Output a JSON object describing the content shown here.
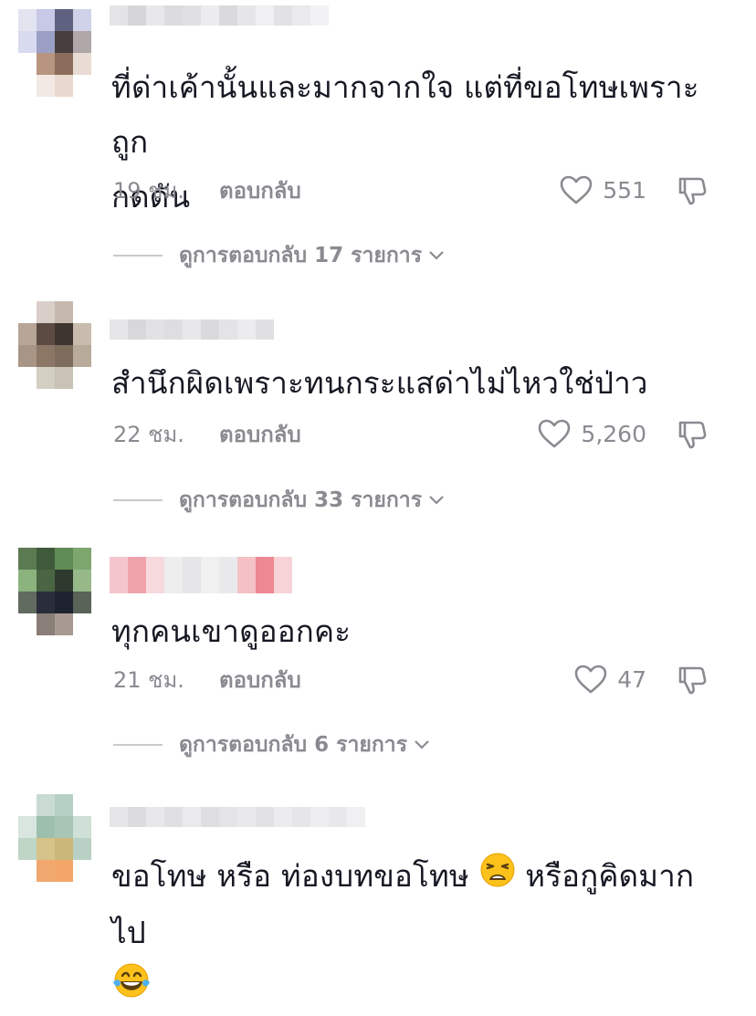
{
  "comments": [
    {
      "text_line1": "ที่ด่าเค้านั้นและมากจากใจ แต่ที่ขอโทษเพราะถูก",
      "text_line2": "กดดัน",
      "time": "19 ชม.",
      "reply_label": "ตอบกลับ",
      "likes": "551",
      "view_replies": "ดูการตอบกลับ 17 รายการ"
    },
    {
      "text_line1": "สำนึกผิดเพราะทนกระแสด่าไม่ไหวใช่ป่าว",
      "time": "22 ชม.",
      "reply_label": "ตอบกลับ",
      "likes": "5,260",
      "view_replies": "ดูการตอบกลับ 33 รายการ"
    },
    {
      "text_line1": "ทุกคนเขาดูออกคะ",
      "time": "21 ชม.",
      "reply_label": "ตอบกลับ",
      "likes": "47",
      "view_replies": "ดูการตอบกลับ 6 รายการ"
    },
    {
      "text_line1_a": "ขอโทษ หรือ ท่องบทขอโทษ",
      "text_line1_b": "หรือกูคิดมากไป",
      "emoji1": "weary-face-emoji",
      "emoji2": "face-with-tears-of-joy-emoji"
    }
  ],
  "icons": {
    "like": "heart-outline-icon",
    "dislike": "thumbs-down-outline-icon",
    "expand": "chevron-down-icon"
  },
  "colors": {
    "text_primary": "#161823",
    "text_secondary": "#8a8b91"
  }
}
